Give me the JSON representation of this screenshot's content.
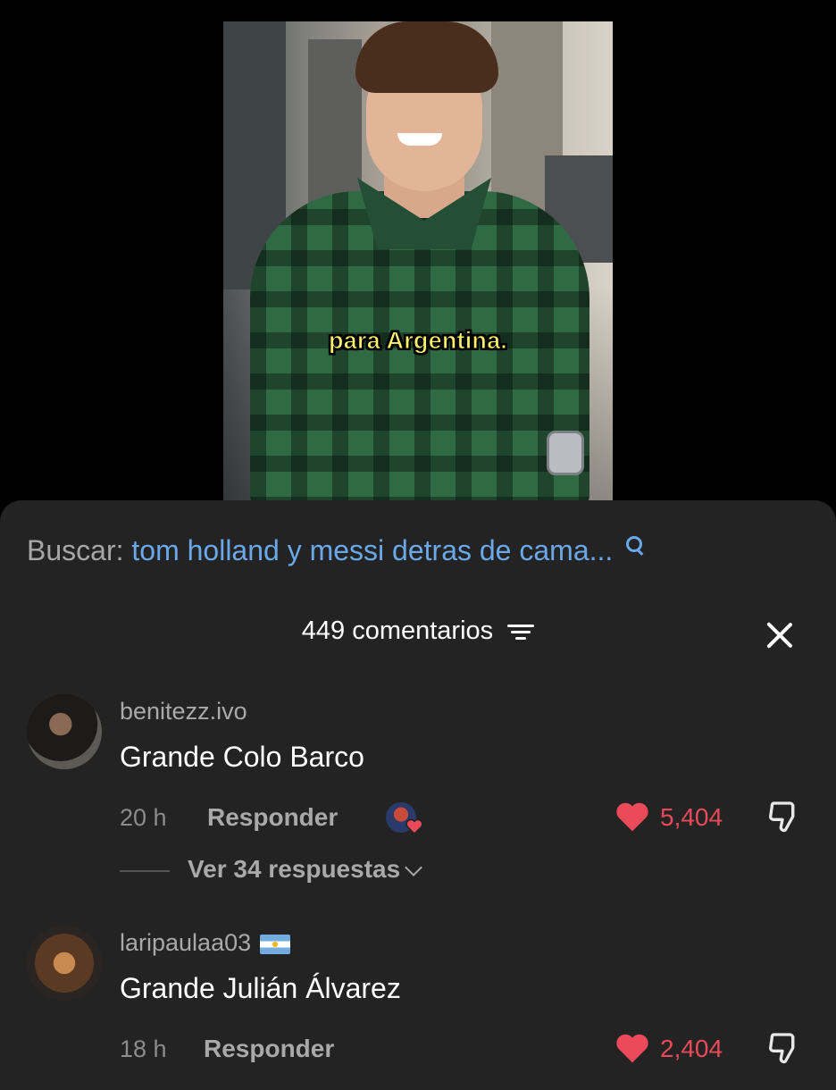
{
  "video": {
    "caption": "para Argentina."
  },
  "search": {
    "prefix": "Buscar:",
    "query": "tom holland y messi detras de cama..."
  },
  "comments_header": {
    "title": "449 comentarios"
  },
  "comments": [
    {
      "username": "benitezz.ivo",
      "text": "Grande Colo Barco",
      "time": "20 h",
      "reply_label": "Responder",
      "likes": "5,404",
      "liked_by_creator": true,
      "view_replies": "Ver 34 respuestas"
    },
    {
      "username": "laripaulaa03",
      "text": "Grande Julián Álvarez",
      "time": "18 h",
      "reply_label": "Responder",
      "likes": "2,404",
      "flag": "argentina-flag-icon"
    }
  ],
  "colors": {
    "sheet_bg": "#232323",
    "search_query": "#6aa8ea",
    "like_red": "#ea4a5a",
    "caption_yellow": "#fff36a"
  }
}
